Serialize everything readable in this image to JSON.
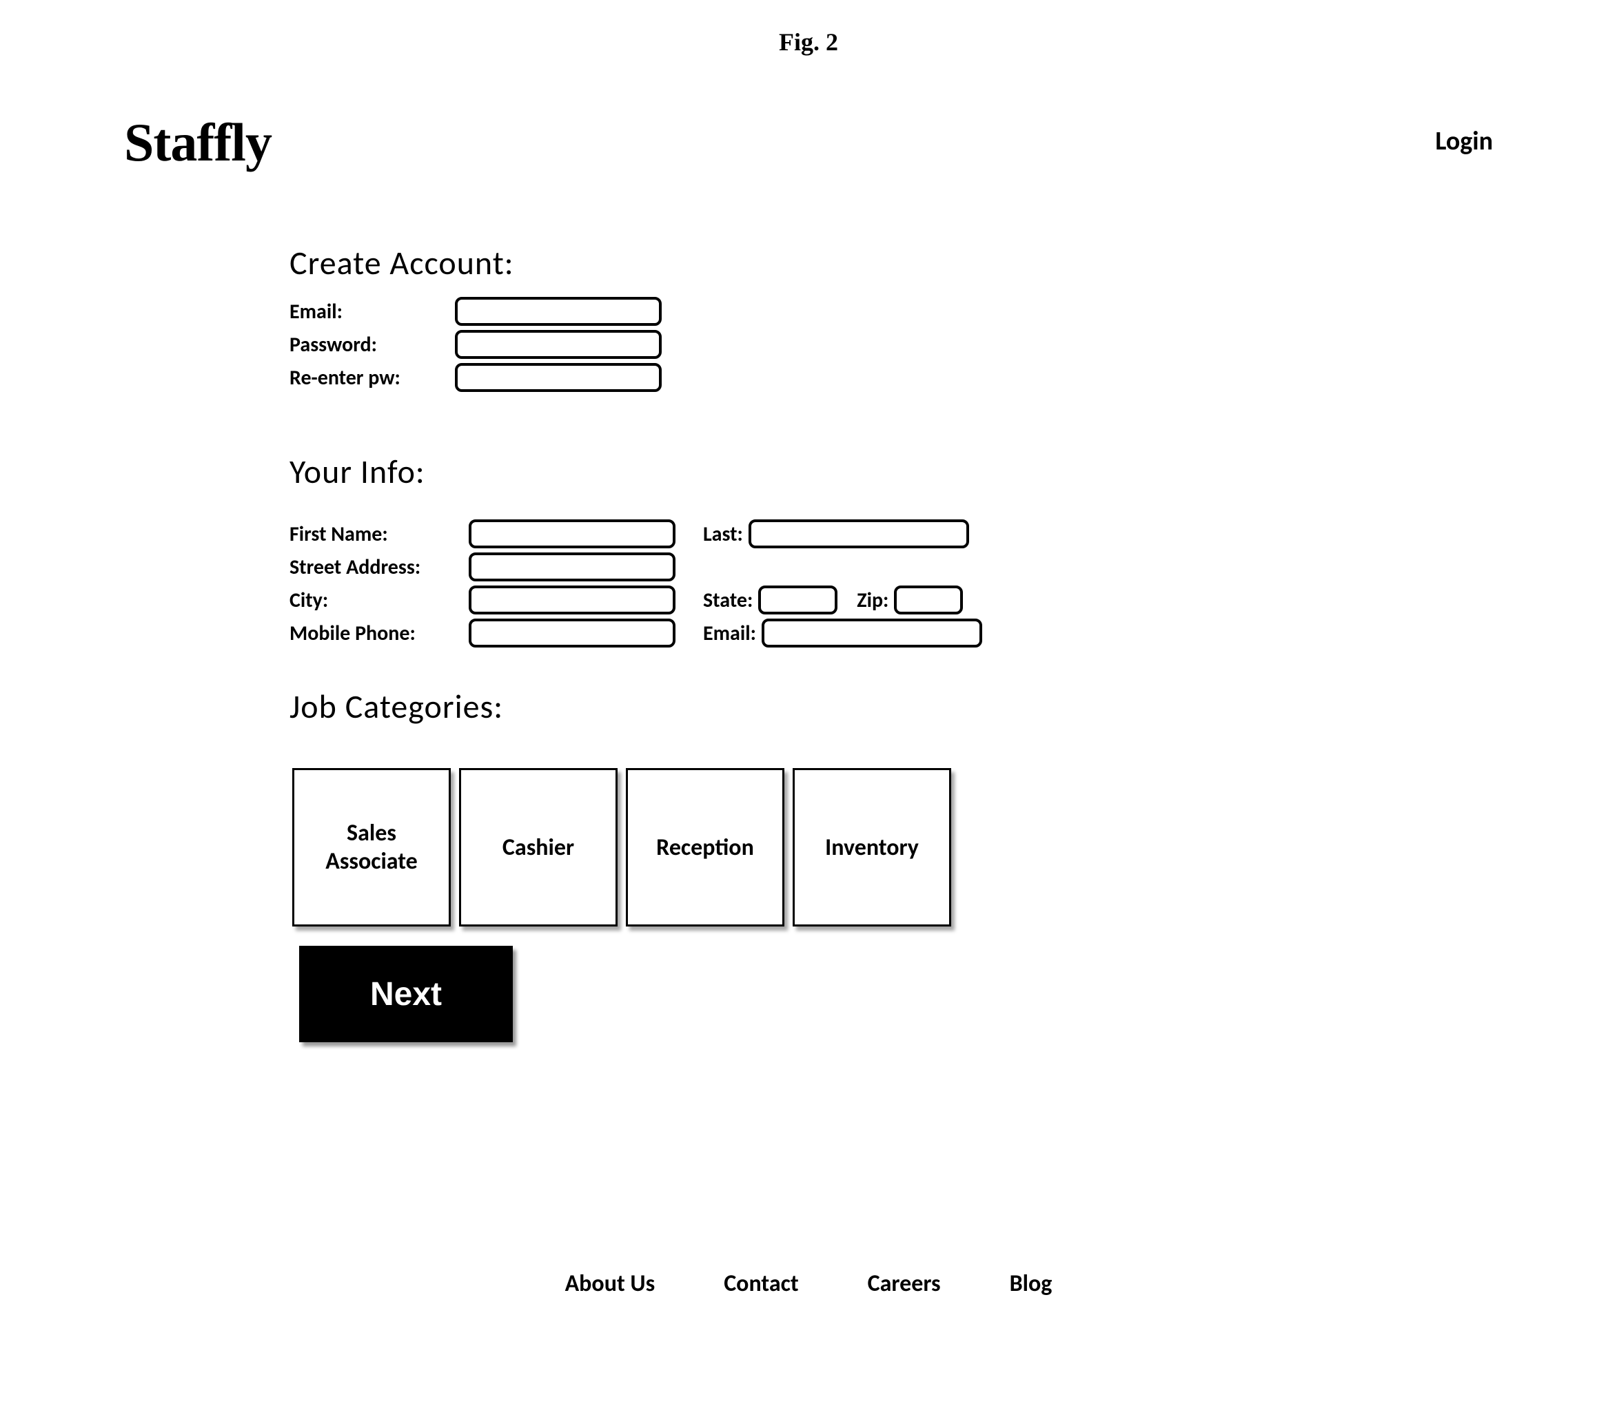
{
  "figure_label": "Fig. 2",
  "brand": "Staffly",
  "login_link": "Login",
  "create_account": {
    "title": "Create Account:",
    "email_label": "Email:",
    "email_value": "",
    "password_label": "Password:",
    "password_value": "",
    "reenter_label": "Re-enter pw:",
    "reenter_value": ""
  },
  "your_info": {
    "title": "Your Info:",
    "first_name_label": "First Name:",
    "first_name_value": "",
    "last_label": "Last:",
    "last_value": "",
    "street_address_label": "Street Address:",
    "street_address_value": "",
    "city_label": "City:",
    "city_value": "",
    "state_label": "State:",
    "state_value": "",
    "zip_label": "Zip:",
    "zip_value": "",
    "mobile_label": "Mobile Phone:",
    "mobile_value": "",
    "email_label": "Email:",
    "email_value": ""
  },
  "job_categories": {
    "title": "Job Categories:",
    "tiles": [
      "Sales Associate",
      "Cashier",
      "Reception",
      "Inventory"
    ]
  },
  "next_label": "Next",
  "footer": {
    "about": "About Us",
    "contact": "Contact",
    "careers": "Careers",
    "blog": "Blog"
  }
}
